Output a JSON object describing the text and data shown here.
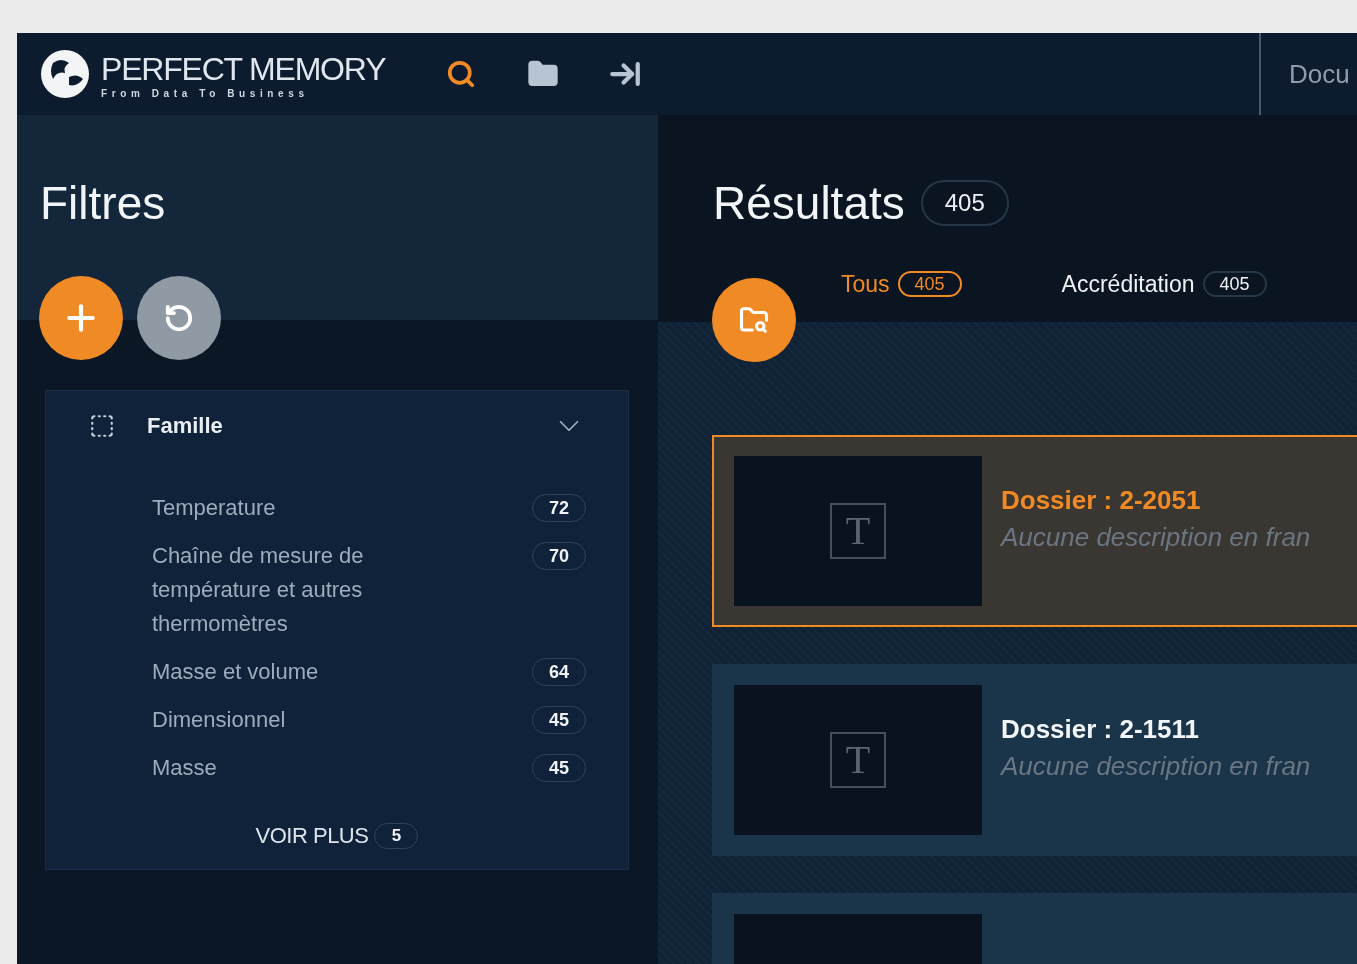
{
  "header": {
    "logo": {
      "title": "PERFECT MEMORY",
      "tagline": "From Data To Business"
    },
    "tools": [
      {
        "kind": "search",
        "selected": true
      },
      {
        "kind": "folder",
        "selected": false
      },
      {
        "kind": "exit",
        "selected": false
      }
    ],
    "nav_items": [
      {
        "label": "Docu",
        "selected": false
      }
    ]
  },
  "filters": {
    "title": "Filtres",
    "groups": [
      {
        "title": "Famille",
        "expanded": true,
        "items": [
          {
            "label": "Temperature",
            "count": "72"
          },
          {
            "label": "Chaîne de mesure de température et autres thermomètres",
            "count": "70"
          },
          {
            "label": "Masse et volume",
            "count": "64"
          },
          {
            "label": "Dimensionnel",
            "count": "45"
          },
          {
            "label": "Masse",
            "count": "45"
          }
        ],
        "more": {
          "label": "VOIR PLUS",
          "count": "5"
        }
      }
    ]
  },
  "results": {
    "title": "Résultats",
    "count": "405",
    "tabs": [
      {
        "label": "Tous",
        "count": "405",
        "selected": true
      },
      {
        "label": "Accréditation",
        "count": "405",
        "selected": false
      }
    ],
    "cards": [
      {
        "type_icon": "T",
        "title": "Dossier : 2-2051",
        "description": "Aucune description en fran",
        "selected": true
      },
      {
        "type_icon": "T",
        "title": "Dossier : 2-1511",
        "description": "Aucune description en fran",
        "selected": false
      },
      {
        "selected": false
      }
    ]
  }
}
